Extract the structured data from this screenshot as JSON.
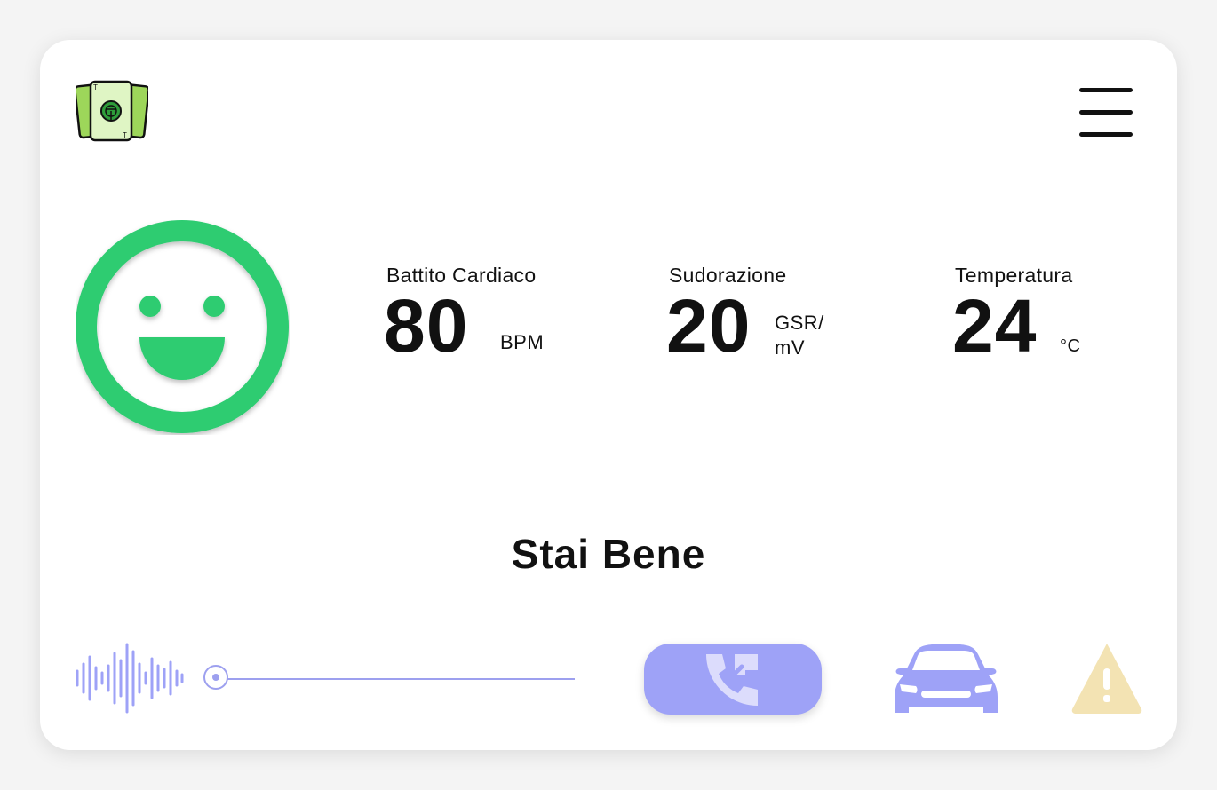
{
  "header": {
    "logo_icon": "driver-cards-logo-icon",
    "menu_icon": "hamburger-menu-icon"
  },
  "mood": {
    "icon": "happy-face-icon",
    "color": "#2ecc71"
  },
  "metrics": [
    {
      "label": "Battito Cardiaco",
      "value": "80",
      "unit": "BPM"
    },
    {
      "label": "Sudorazione",
      "value": "20",
      "unit": "GSR/ mV"
    },
    {
      "label": "Temperatura",
      "value": "24",
      "unit": "°C"
    }
  ],
  "status": {
    "text": "Stai Bene"
  },
  "bottom_bar": {
    "audio_icon": "sound-wave-icon",
    "slider_level": 0,
    "call_icon": "phone-call-icon",
    "car_icon": "car-icon",
    "warning_icon": "warning-icon"
  },
  "colors": {
    "accent": "#9ea2f7",
    "mood_green": "#2ecc71",
    "warning": "#f3e3b3",
    "text": "#111111"
  }
}
